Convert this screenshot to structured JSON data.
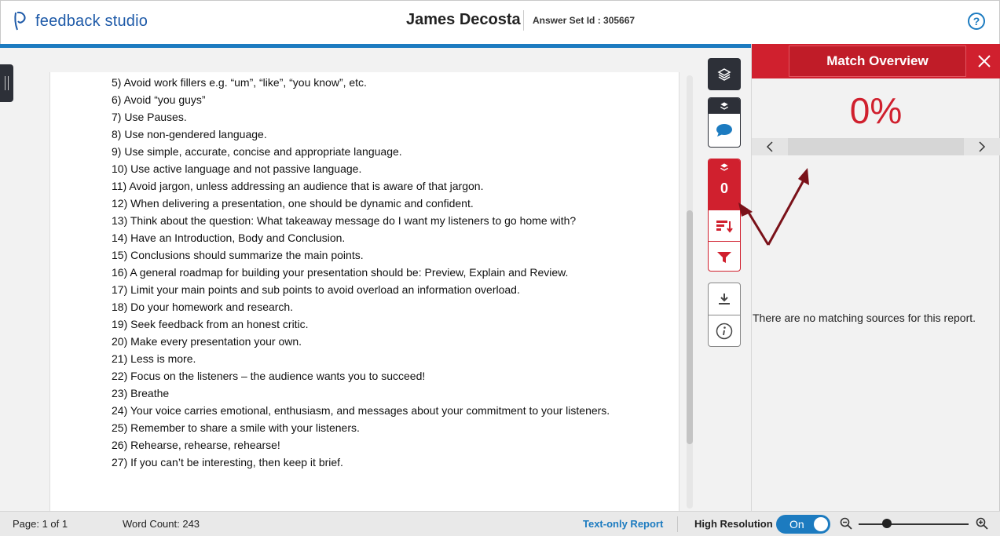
{
  "header": {
    "logo_text": "feedback studio",
    "student_name": "James Decosta",
    "answer_set_label": "Answer Set Id : 305667",
    "help_label": "?"
  },
  "document": {
    "lines": [
      "5)   Avoid work fillers e.g. “um”, “like”, “you know”, etc.",
      "6)   Avoid “you guys”",
      "7)   Use Pauses.",
      "8)   Use non-gendered language.",
      "9)   Use simple, accurate, concise and appropriate language.",
      "10) Use active language and not passive language.",
      "11) Avoid jargon, unless addressing an audience that is aware of that jargon.",
      "12) When delivering a presentation, one should be dynamic and confident.",
      "13) Think about the question: What takeaway message do I want my listeners to go home with?",
      "14) Have an Introduction, Body and Conclusion.",
      "15) Conclusions should summarize the main points.",
      "16) A general roadmap for building your presentation should be: Preview, Explain and Review.",
      "17) Limit your main points and sub points to avoid overload an information overload.",
      "18) Do your homework and research.",
      "19) Seek feedback from an honest critic.",
      "20) Make every presentation your own.",
      "21) Less is more.",
      "22) Focus on the listeners – the audience wants you to succeed!",
      "23) Breathe",
      "24) Your voice carries emotional, enthusiasm, and messages about your commitment to your listeners.",
      "25) Remember to share a smile with your listeners.",
      "26) Rehearse, rehearse, rehearse!",
      "27) If you can’t be interesting, then keep it brief."
    ]
  },
  "toolbar": {
    "similarity_score": "0",
    "icons": [
      "layers-icon",
      "comment-icon",
      "sort-icon",
      "filter-icon",
      "download-icon",
      "info-icon"
    ]
  },
  "panel": {
    "title": "Match Overview",
    "match_percent": "0%",
    "empty_message": "There are no matching sources for this report."
  },
  "footer": {
    "page": "Page: 1 of 1",
    "word_count": "Word Count: 243",
    "text_only": "Text-only Report",
    "high_resolution": "High Resolution",
    "toggle_state": "On"
  },
  "colors": {
    "brand_blue": "#1c7bc0",
    "similarity_red": "#d0202e",
    "dark_tool": "#2d3038"
  }
}
